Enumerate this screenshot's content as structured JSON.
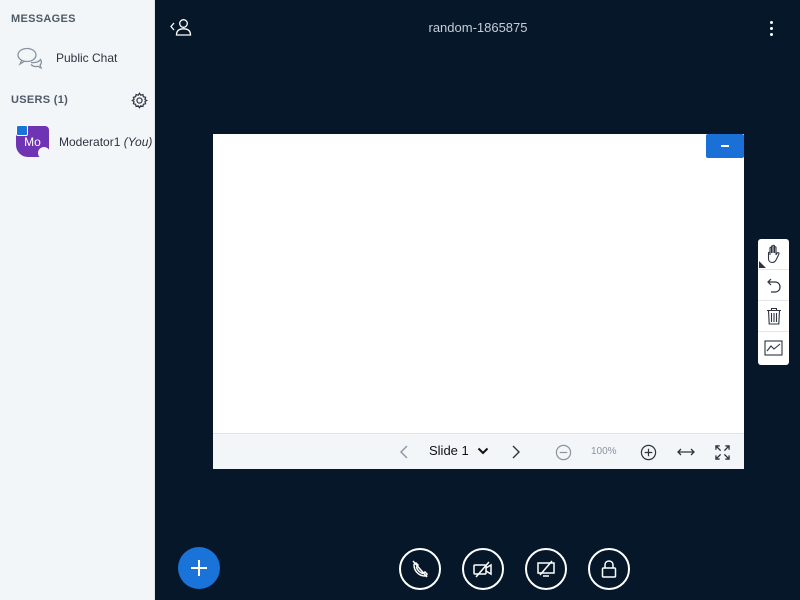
{
  "sidebar": {
    "messages_heading": "MESSAGES",
    "public_chat_label": "Public Chat",
    "users_heading": "USERS (1)",
    "user": {
      "initials": "Mo",
      "name": "Moderator1",
      "you_suffix": "(You)"
    }
  },
  "header": {
    "meeting_title": "random-1865875"
  },
  "presentation": {
    "slide_label": "Slide 1",
    "zoom_level": "100%"
  },
  "colors": {
    "background": "#06172a",
    "accent": "#1a73d9",
    "avatar": "#6e34b4"
  },
  "icons": {
    "chat": "chat-bubbles-icon",
    "settings": "gear-icon",
    "users_toggle": "user-toggle-icon",
    "more": "kebab-icon",
    "hand": "hand-tool-icon",
    "undo": "undo-icon",
    "delete": "trash-icon",
    "multiuser": "multi-user-board-icon",
    "add": "plus-icon",
    "audio": "phone-off-icon",
    "video": "camera-off-icon",
    "screen": "screenshare-off-icon",
    "lock": "lock-icon"
  }
}
